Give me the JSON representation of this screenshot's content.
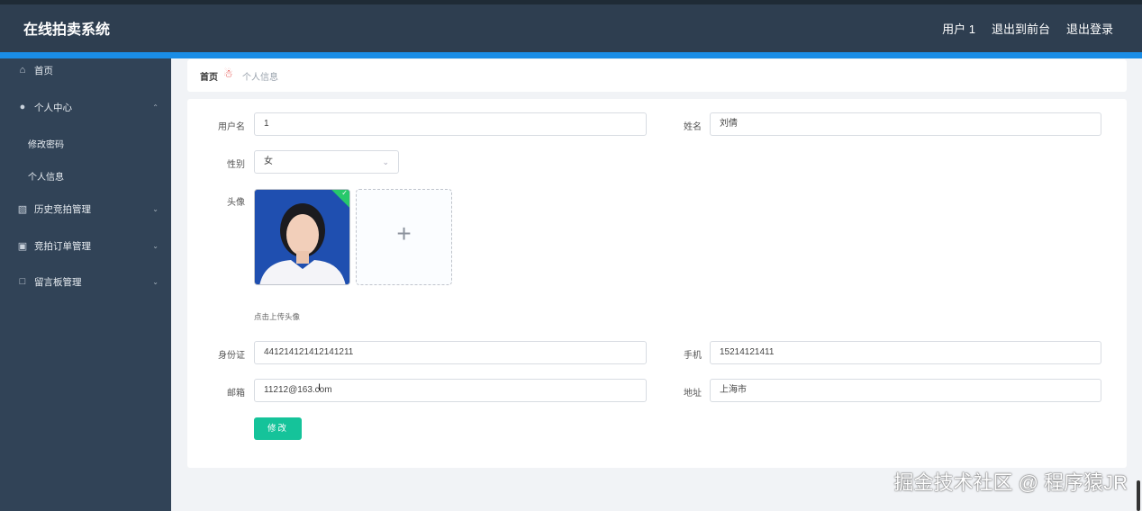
{
  "app": {
    "title": "在线拍卖系统"
  },
  "topnav": {
    "user": "用户 1",
    "front": "退出到前台",
    "logout": "退出登录"
  },
  "sidebar": {
    "home": "首页",
    "personal_center": "个人中心",
    "change_password": "修改密码",
    "personal_info": "个人信息",
    "history_bids": "历史竞拍管理",
    "bid_orders": "竞拍订单管理",
    "message_board": "留言板管理"
  },
  "breadcrumb": {
    "home": "首页",
    "separator": "☃",
    "current": "个人信息"
  },
  "form": {
    "username_label": "用户名",
    "username_value": "1",
    "name_label": "姓名",
    "name_value": "刘倩",
    "gender_label": "性别",
    "gender_value": "女",
    "avatar_label": "头像",
    "upload_tip": "点击上传头像",
    "id_label": "身份证",
    "id_value": "441214121412141211",
    "phone_label": "手机",
    "phone_value": "15214121411",
    "email_label": "邮箱",
    "email_value": "11212@163.com",
    "address_label": "地址",
    "address_value": "上海市",
    "submit_label": "修改"
  },
  "watermark": "掘金技术社区 @ 程序猿JR",
  "colors": {
    "header": "#2e3e50",
    "sidebar": "#314357",
    "accent": "#1a8de6",
    "submit": "#15c39a"
  }
}
